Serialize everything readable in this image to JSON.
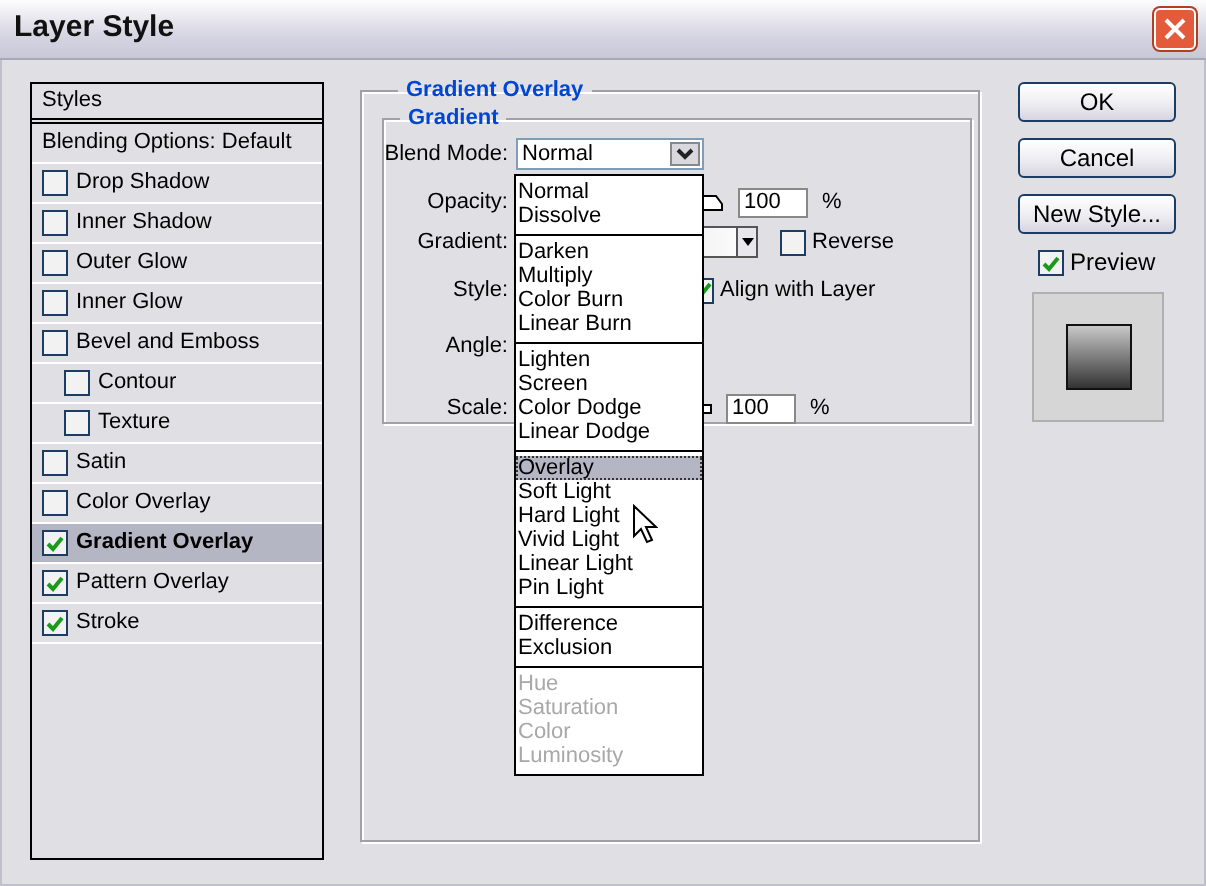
{
  "window": {
    "title": "Layer Style"
  },
  "styles_panel": {
    "header": "Styles",
    "blending": "Blending Options: Default",
    "items": [
      {
        "label": "Drop Shadow",
        "checked": false,
        "selected": false
      },
      {
        "label": "Inner Shadow",
        "checked": false,
        "selected": false
      },
      {
        "label": "Outer Glow",
        "checked": false,
        "selected": false
      },
      {
        "label": "Inner Glow",
        "checked": false,
        "selected": false
      },
      {
        "label": "Bevel and Emboss",
        "checked": false,
        "selected": false,
        "children": [
          {
            "label": "Contour",
            "checked": false,
            "selected": false
          },
          {
            "label": "Texture",
            "checked": false,
            "selected": false
          }
        ]
      },
      {
        "label": "Satin",
        "checked": false,
        "selected": false
      },
      {
        "label": "Color Overlay",
        "checked": false,
        "selected": false
      },
      {
        "label": "Gradient Overlay",
        "checked": true,
        "selected": true
      },
      {
        "label": "Pattern Overlay",
        "checked": true,
        "selected": false
      },
      {
        "label": "Stroke",
        "checked": true,
        "selected": false
      }
    ]
  },
  "section": {
    "title": "Gradient Overlay",
    "group": "Gradient",
    "blend_mode": {
      "label": "Blend Mode:",
      "value": "Normal"
    },
    "opacity": {
      "label": "Opacity:",
      "value": "100",
      "unit": "%"
    },
    "gradient": {
      "label": "Gradient:",
      "reverse": {
        "label": "Reverse",
        "checked": false
      }
    },
    "style": {
      "label": "Style:",
      "align": {
        "label": "Align with Layer",
        "checked": true
      }
    },
    "angle": {
      "label": "Angle:"
    },
    "scale": {
      "label": "Scale:",
      "value": "100",
      "unit": "%"
    }
  },
  "blend_menu": {
    "groups": [
      {
        "items": [
          {
            "label": "Normal",
            "selected": false,
            "disabled": false
          },
          {
            "label": "Dissolve",
            "selected": false,
            "disabled": false
          }
        ]
      },
      {
        "items": [
          {
            "label": "Darken",
            "selected": false,
            "disabled": false
          },
          {
            "label": "Multiply",
            "selected": false,
            "disabled": false
          },
          {
            "label": "Color Burn",
            "selected": false,
            "disabled": false
          },
          {
            "label": "Linear Burn",
            "selected": false,
            "disabled": false
          }
        ]
      },
      {
        "items": [
          {
            "label": "Lighten",
            "selected": false,
            "disabled": false
          },
          {
            "label": "Screen",
            "selected": false,
            "disabled": false
          },
          {
            "label": "Color Dodge",
            "selected": false,
            "disabled": false
          },
          {
            "label": "Linear Dodge",
            "selected": false,
            "disabled": false
          }
        ]
      },
      {
        "items": [
          {
            "label": "Overlay",
            "selected": true,
            "disabled": false
          },
          {
            "label": "Soft Light",
            "selected": false,
            "disabled": false
          },
          {
            "label": "Hard Light",
            "selected": false,
            "disabled": false
          },
          {
            "label": "Vivid Light",
            "selected": false,
            "disabled": false
          },
          {
            "label": "Linear Light",
            "selected": false,
            "disabled": false
          },
          {
            "label": "Pin Light",
            "selected": false,
            "disabled": false
          }
        ]
      },
      {
        "items": [
          {
            "label": "Difference",
            "selected": false,
            "disabled": false
          },
          {
            "label": "Exclusion",
            "selected": false,
            "disabled": false
          }
        ]
      },
      {
        "items": [
          {
            "label": "Hue",
            "selected": false,
            "disabled": true
          },
          {
            "label": "Saturation",
            "selected": false,
            "disabled": true
          },
          {
            "label": "Color",
            "selected": false,
            "disabled": true
          },
          {
            "label": "Luminosity",
            "selected": false,
            "disabled": true
          }
        ]
      }
    ]
  },
  "buttons": [
    "OK",
    "Cancel",
    "New Style..."
  ],
  "preview": {
    "label": "Preview",
    "checked": true
  }
}
